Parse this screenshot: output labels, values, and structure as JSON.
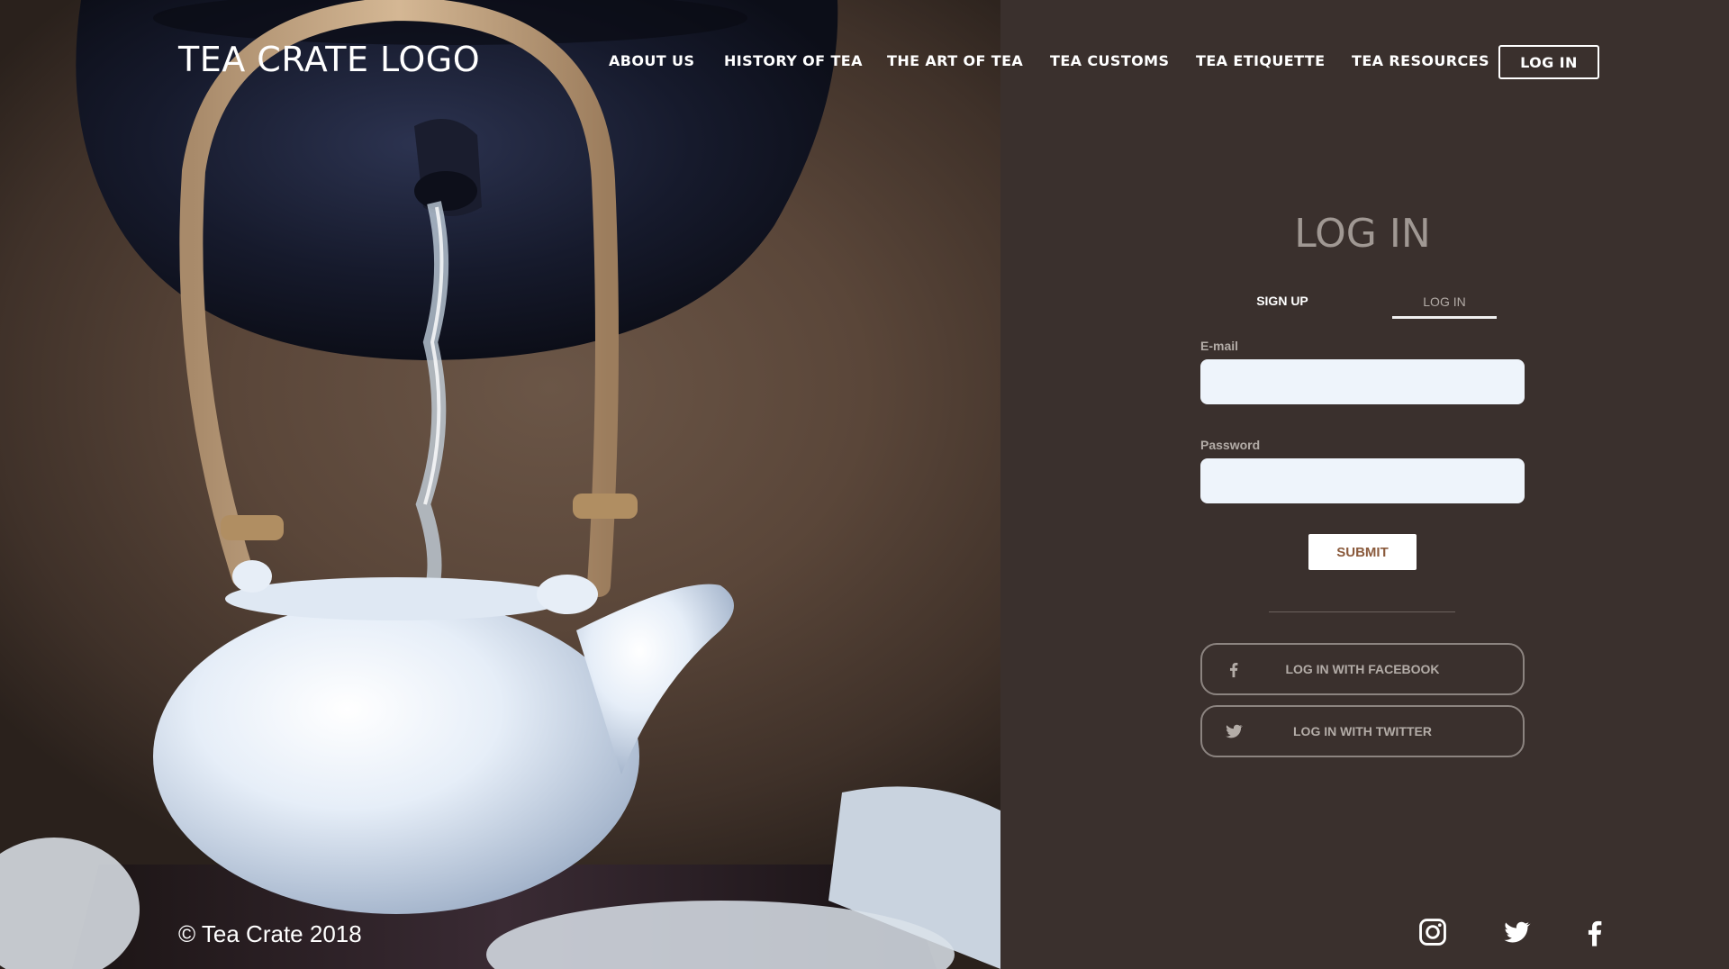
{
  "brand": {
    "logo_text": "TEA CRATE LOGO"
  },
  "nav": {
    "items": [
      {
        "label": "ABOUT US"
      },
      {
        "label": "HISTORY OF TEA"
      },
      {
        "label": "THE ART OF TEA"
      },
      {
        "label": "TEA CUSTOMS"
      },
      {
        "label": "TEA ETIQUETTE"
      },
      {
        "label": "TEA RESOURCES"
      }
    ],
    "login_button": "LOG IN"
  },
  "login_form": {
    "title": "LOG IN",
    "tabs": [
      {
        "label": "SIGN UP",
        "active": false
      },
      {
        "label": "LOG IN",
        "active": true
      }
    ],
    "email_label": "E-mail",
    "email_value": "",
    "password_label": "Password",
    "password_value": "",
    "submit_label": "SUBMIT",
    "facebook_label": "LOG IN WITH FACEBOOK",
    "twitter_label": "LOG IN WITH TWITTER"
  },
  "footer": {
    "copyright": "© Tea Crate 2018",
    "social_icons": [
      "instagram-icon",
      "twitter-icon",
      "facebook-icon"
    ]
  },
  "colors": {
    "panel_background": "#3a302d",
    "input_background": "#eef4fb",
    "submit_text": "#8a5a3c",
    "muted_text": "#b3aca7"
  }
}
